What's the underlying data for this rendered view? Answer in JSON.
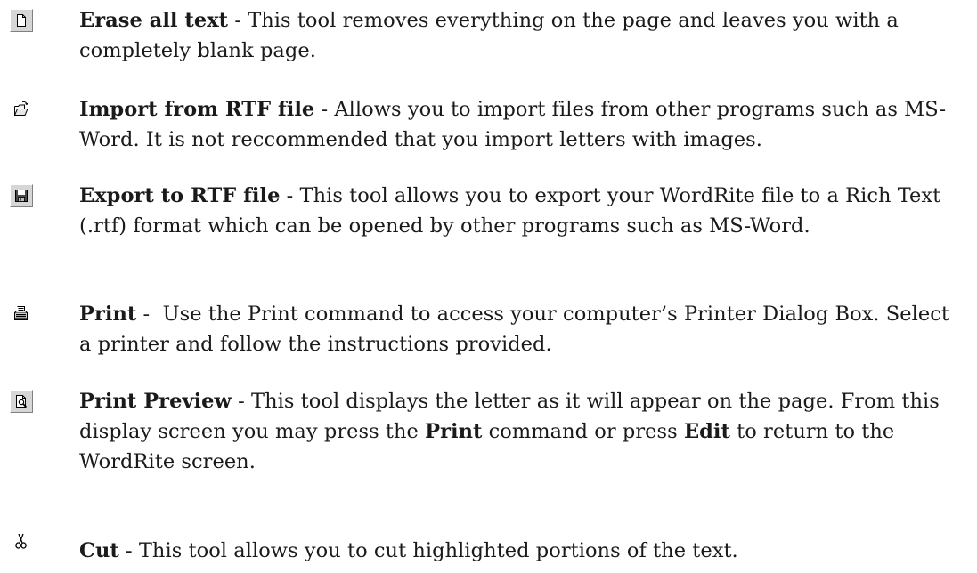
{
  "entries": [
    {
      "icon": "new-page-icon",
      "title": "Erase all text",
      "separator": " - ",
      "description": "This tool removes everything on the page and leaves you with a completely blank page."
    },
    {
      "icon": "open-folder-icon",
      "title": "Import from RTF file",
      "separator": " - ",
      "description": "Allows you to import files from other programs such as MS-Word. It is not reccommended that you import letters with images."
    },
    {
      "icon": "floppy-disk-icon",
      "title": "Export to RTF file",
      "separator": " - ",
      "description": "This tool allows you to export your WordRite file to a Rich Text (.rtf) format which can be opened by other programs such as MS-Word."
    },
    {
      "icon": "printer-icon",
      "title": "Print",
      "separator": " -  ",
      "description": "Use the Print command to access your computer’s Printer Dialog Box. Select a printer and follow the instructions provided."
    },
    {
      "icon": "print-preview-icon",
      "title": "Print Preview",
      "separator": " - ",
      "description_part1": "This tool displays the letter as it will appear on the page. From this display screen you may press the ",
      "bold_word1": "Print",
      "description_part2": " command or press ",
      "bold_word2": "Edit",
      "description_part3": " to return to the WordRite screen."
    },
    {
      "icon": "scissors-icon",
      "title": "Cut",
      "separator": " - ",
      "description": "This tool allows you to cut highlighted portions of the text."
    }
  ]
}
